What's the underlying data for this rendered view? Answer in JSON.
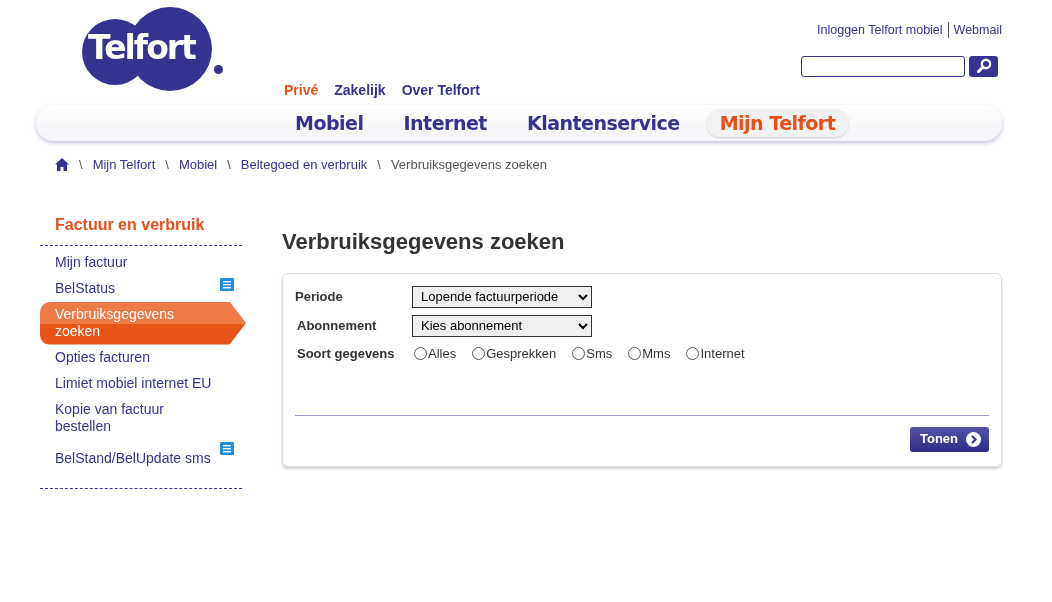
{
  "logo": {
    "text": "Telfort"
  },
  "top_links": [
    "Inloggen Telfort mobiel",
    "Webmail"
  ],
  "segments": [
    {
      "label": "Privé",
      "selected": true
    },
    {
      "label": "Zakelijk",
      "selected": false
    },
    {
      "label": "Over Telfort",
      "selected": false
    }
  ],
  "main_nav": [
    {
      "label": "Mobiel",
      "selected": false
    },
    {
      "label": "Internet",
      "selected": false
    },
    {
      "label": "Klantenservice",
      "selected": false
    },
    {
      "label": "Mijn Telfort",
      "selected": true
    }
  ],
  "breadcrumb": [
    {
      "separator": "\\",
      "label": "Mijn Telfort"
    },
    {
      "separator": "\\",
      "label": "Mobiel"
    },
    {
      "separator": "\\",
      "label": "Beltegoed en verbruik"
    },
    {
      "separator": "\\",
      "label": "Verbruiksgegevens zoeken"
    }
  ],
  "sidebar": {
    "title": "Factuur en verbruik",
    "items": [
      {
        "label": "Mijn factuur",
        "selected": false,
        "note": false
      },
      {
        "label": "BelStatus",
        "selected": false,
        "note": true
      },
      {
        "label": "Verbruiksgegevens zoeken",
        "selected": true,
        "note": false
      },
      {
        "label": "Opties facturen",
        "selected": false,
        "note": false
      },
      {
        "label": "Limiet mobiel internet EU",
        "selected": false,
        "note": false
      },
      {
        "label": "Kopie van factuur bestellen",
        "selected": false,
        "note": false
      },
      {
        "label": "BelStand/BelUpdate sms",
        "selected": false,
        "note": true
      }
    ]
  },
  "heading": "Verbruiksgegevens zoeken",
  "form": {
    "fields": [
      {
        "label": "Periode",
        "value": "Lopende factuurperiode"
      },
      {
        "label": "Abonnement",
        "value": "Kies abonnement"
      }
    ],
    "type_label": "Soort gegevens",
    "types": [
      {
        "label": "Alles",
        "selected": false
      },
      {
        "label": "Gesprekken",
        "selected": false
      },
      {
        "label": "Sms",
        "selected": false
      },
      {
        "label": "Mms",
        "selected": false
      },
      {
        "label": "Internet",
        "selected": false
      }
    ],
    "submit": "Tonen"
  }
}
